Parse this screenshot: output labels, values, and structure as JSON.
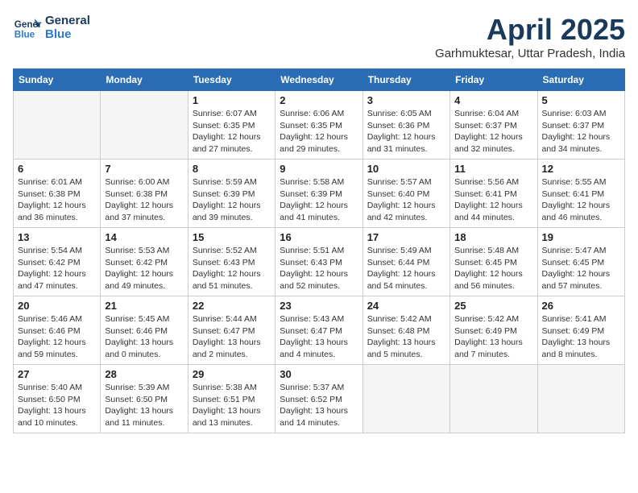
{
  "logo": {
    "line1": "General",
    "line2": "Blue"
  },
  "title": "April 2025",
  "subtitle": "Garhmuktesar, Uttar Pradesh, India",
  "days_header": [
    "Sunday",
    "Monday",
    "Tuesday",
    "Wednesday",
    "Thursday",
    "Friday",
    "Saturday"
  ],
  "weeks": [
    [
      {
        "day": "",
        "info": ""
      },
      {
        "day": "",
        "info": ""
      },
      {
        "day": "1",
        "info": "Sunrise: 6:07 AM\nSunset: 6:35 PM\nDaylight: 12 hours and 27 minutes."
      },
      {
        "day": "2",
        "info": "Sunrise: 6:06 AM\nSunset: 6:35 PM\nDaylight: 12 hours and 29 minutes."
      },
      {
        "day": "3",
        "info": "Sunrise: 6:05 AM\nSunset: 6:36 PM\nDaylight: 12 hours and 31 minutes."
      },
      {
        "day": "4",
        "info": "Sunrise: 6:04 AM\nSunset: 6:37 PM\nDaylight: 12 hours and 32 minutes."
      },
      {
        "day": "5",
        "info": "Sunrise: 6:03 AM\nSunset: 6:37 PM\nDaylight: 12 hours and 34 minutes."
      }
    ],
    [
      {
        "day": "6",
        "info": "Sunrise: 6:01 AM\nSunset: 6:38 PM\nDaylight: 12 hours and 36 minutes."
      },
      {
        "day": "7",
        "info": "Sunrise: 6:00 AM\nSunset: 6:38 PM\nDaylight: 12 hours and 37 minutes."
      },
      {
        "day": "8",
        "info": "Sunrise: 5:59 AM\nSunset: 6:39 PM\nDaylight: 12 hours and 39 minutes."
      },
      {
        "day": "9",
        "info": "Sunrise: 5:58 AM\nSunset: 6:39 PM\nDaylight: 12 hours and 41 minutes."
      },
      {
        "day": "10",
        "info": "Sunrise: 5:57 AM\nSunset: 6:40 PM\nDaylight: 12 hours and 42 minutes."
      },
      {
        "day": "11",
        "info": "Sunrise: 5:56 AM\nSunset: 6:41 PM\nDaylight: 12 hours and 44 minutes."
      },
      {
        "day": "12",
        "info": "Sunrise: 5:55 AM\nSunset: 6:41 PM\nDaylight: 12 hours and 46 minutes."
      }
    ],
    [
      {
        "day": "13",
        "info": "Sunrise: 5:54 AM\nSunset: 6:42 PM\nDaylight: 12 hours and 47 minutes."
      },
      {
        "day": "14",
        "info": "Sunrise: 5:53 AM\nSunset: 6:42 PM\nDaylight: 12 hours and 49 minutes."
      },
      {
        "day": "15",
        "info": "Sunrise: 5:52 AM\nSunset: 6:43 PM\nDaylight: 12 hours and 51 minutes."
      },
      {
        "day": "16",
        "info": "Sunrise: 5:51 AM\nSunset: 6:43 PM\nDaylight: 12 hours and 52 minutes."
      },
      {
        "day": "17",
        "info": "Sunrise: 5:49 AM\nSunset: 6:44 PM\nDaylight: 12 hours and 54 minutes."
      },
      {
        "day": "18",
        "info": "Sunrise: 5:48 AM\nSunset: 6:45 PM\nDaylight: 12 hours and 56 minutes."
      },
      {
        "day": "19",
        "info": "Sunrise: 5:47 AM\nSunset: 6:45 PM\nDaylight: 12 hours and 57 minutes."
      }
    ],
    [
      {
        "day": "20",
        "info": "Sunrise: 5:46 AM\nSunset: 6:46 PM\nDaylight: 12 hours and 59 minutes."
      },
      {
        "day": "21",
        "info": "Sunrise: 5:45 AM\nSunset: 6:46 PM\nDaylight: 13 hours and 0 minutes."
      },
      {
        "day": "22",
        "info": "Sunrise: 5:44 AM\nSunset: 6:47 PM\nDaylight: 13 hours and 2 minutes."
      },
      {
        "day": "23",
        "info": "Sunrise: 5:43 AM\nSunset: 6:47 PM\nDaylight: 13 hours and 4 minutes."
      },
      {
        "day": "24",
        "info": "Sunrise: 5:42 AM\nSunset: 6:48 PM\nDaylight: 13 hours and 5 minutes."
      },
      {
        "day": "25",
        "info": "Sunrise: 5:42 AM\nSunset: 6:49 PM\nDaylight: 13 hours and 7 minutes."
      },
      {
        "day": "26",
        "info": "Sunrise: 5:41 AM\nSunset: 6:49 PM\nDaylight: 13 hours and 8 minutes."
      }
    ],
    [
      {
        "day": "27",
        "info": "Sunrise: 5:40 AM\nSunset: 6:50 PM\nDaylight: 13 hours and 10 minutes."
      },
      {
        "day": "28",
        "info": "Sunrise: 5:39 AM\nSunset: 6:50 PM\nDaylight: 13 hours and 11 minutes."
      },
      {
        "day": "29",
        "info": "Sunrise: 5:38 AM\nSunset: 6:51 PM\nDaylight: 13 hours and 13 minutes."
      },
      {
        "day": "30",
        "info": "Sunrise: 5:37 AM\nSunset: 6:52 PM\nDaylight: 13 hours and 14 minutes."
      },
      {
        "day": "",
        "info": ""
      },
      {
        "day": "",
        "info": ""
      },
      {
        "day": "",
        "info": ""
      }
    ]
  ]
}
